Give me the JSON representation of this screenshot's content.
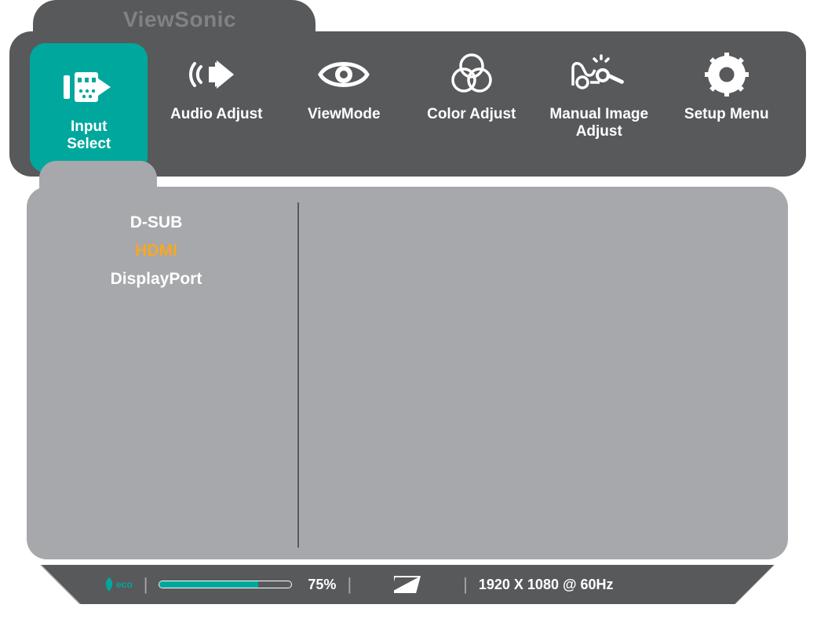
{
  "brand": "ViewSonic",
  "nav": {
    "items": [
      {
        "id": "input-select",
        "label": "Input\nSelect",
        "active": true
      },
      {
        "id": "audio-adjust",
        "label": "Audio Adjust",
        "active": false
      },
      {
        "id": "view-mode",
        "label": "ViewMode",
        "active": false
      },
      {
        "id": "color-adjust",
        "label": "Color Adjust",
        "active": false
      },
      {
        "id": "manual-image",
        "label": "Manual Image\nAdjust",
        "active": false
      },
      {
        "id": "setup-menu",
        "label": "Setup Menu",
        "active": false
      }
    ]
  },
  "input_options": [
    {
      "label": "D-SUB",
      "selected": false
    },
    {
      "label": "HDMI",
      "selected": true
    },
    {
      "label": "DisplayPort",
      "selected": false
    }
  ],
  "status": {
    "eco_label": "eco",
    "progress_pct": 75,
    "progress_label": "75%",
    "resolution": "1920 X 1080 @ 60Hz"
  },
  "colors": {
    "accent": "#00a79d",
    "highlight": "#f7a823",
    "frame": "#58595b",
    "panel": "#a6a8ab"
  }
}
